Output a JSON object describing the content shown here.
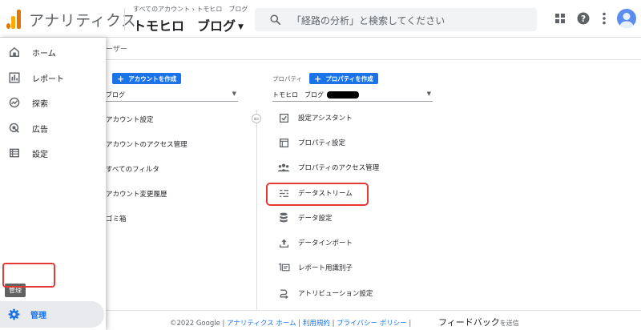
{
  "topbar": {
    "app_title": "アナリティクス",
    "breadcrumb": "すべてのアカウント › トモヒロ　ブログ",
    "property_title": "トモヒロ　ブログ",
    "search_placeholder": "「経路の分析」と検索してください"
  },
  "sidebar": {
    "items": [
      {
        "label": "ホーム",
        "icon": "home-icon"
      },
      {
        "label": "レポート",
        "icon": "reports-icon"
      },
      {
        "label": "探索",
        "icon": "explore-icon"
      },
      {
        "label": "広告",
        "icon": "ads-icon"
      },
      {
        "label": "設定",
        "icon": "settings-list-icon"
      }
    ],
    "tooltip": "管理",
    "admin_label": "管理"
  },
  "main": {
    "header_title": "ーザー",
    "account": {
      "create_button": "アカウントを作成",
      "selected": "ブログ",
      "items": [
        "アカウント設定",
        "アカウントのアクセス管理",
        "すべてのフィルタ",
        "アカウント変更履歴",
        "ゴミ箱"
      ]
    },
    "property": {
      "label": "プロパティ",
      "create_button": "プロパティを作成",
      "selected": "トモヒロ　ブログ",
      "items": [
        {
          "label": "設定アシスタント",
          "icon": "checklist-icon"
        },
        {
          "label": "プロパティ設定",
          "icon": "property-settings-icon"
        },
        {
          "label": "プロパティのアクセス管理",
          "icon": "people-icon"
        },
        {
          "label": "データストリーム",
          "icon": "data-stream-icon"
        },
        {
          "label": "データ設定",
          "icon": "database-icon"
        },
        {
          "label": "データインポート",
          "icon": "upload-icon"
        },
        {
          "label": "レポート用識別子",
          "icon": "identifier-icon"
        },
        {
          "label": "アトリビューション設定",
          "icon": "attribution-icon"
        }
      ]
    }
  },
  "footer": {
    "copyright": "©2022 Google |",
    "links": [
      "アナリティクス ホーム",
      "利用規約",
      "プライバシー ポリシー"
    ],
    "feedback": "フィードバックを送信",
    "feedback_handwritten": "フィードバック"
  },
  "colors": {
    "accent": "#1a73e8",
    "highlight": "#e53935"
  }
}
